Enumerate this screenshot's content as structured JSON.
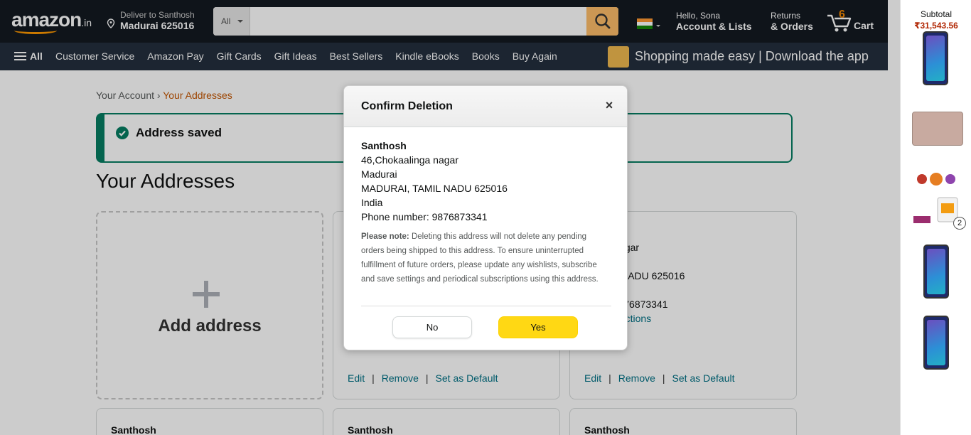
{
  "header": {
    "logo_text": "amazon",
    "logo_suffix": ".in",
    "deliver_line1": "Deliver to Santhosh",
    "deliver_line2": "Madurai 625016",
    "search_category": "All",
    "search_placeholder": "",
    "greeting": "Hello, Sona",
    "account_label": "Account & Lists",
    "returns_line1": "Returns",
    "returns_line2": "& Orders",
    "cart_count": "6",
    "cart_label": "Cart"
  },
  "nav": {
    "all_label": "All",
    "items": [
      "Customer Service",
      "Amazon Pay",
      "Gift Cards",
      "Gift Ideas",
      "Best Sellers",
      "Kindle eBooks",
      "Books",
      "Buy Again"
    ],
    "promo": "Shopping made easy | Download the app"
  },
  "right_panel": {
    "subtotal_label": "Subtotal",
    "subtotal_amount": "₹31,543.56",
    "rakhi_qty": "2"
  },
  "page": {
    "breadcrumb_root": "Your Account",
    "breadcrumb_sep": "›",
    "breadcrumb_current": "Your Addresses",
    "saved_message": "Address saved",
    "heading": "Your Addresses",
    "add_address": "Add address",
    "card3_lines": [
      "alinga nagar",
      "",
      ", TAMIL NADU 625016",
      "",
      "mber: 9876873341"
    ],
    "card3_link": "ery instructions",
    "card_actions": {
      "edit": "Edit",
      "remove": "Remove",
      "default": "Set as Default",
      "sep": "|"
    },
    "bottom_names": [
      "Santhosh",
      "Santhosh",
      "Santhosh"
    ]
  },
  "modal": {
    "title": "Confirm Deletion",
    "close": "×",
    "name": "Santhosh",
    "line1": "46,Chokaalinga nagar",
    "line2": "Madurai",
    "line3": "MADURAI, TAMIL NADU 625016",
    "line4": "India",
    "phone": "Phone number: 9876873341",
    "note_label": "Please note:",
    "note_text": " Deleting this address will not delete any pending orders being shipped to this address. To ensure uninterrupted fulfillment of future orders, please update any wishlists, subscribe and save settings and periodical subscriptions using this address.",
    "no_label": "No",
    "yes_label": "Yes"
  },
  "colors": {
    "header_bg": "#131921",
    "nav_bg": "#232f3e",
    "accent_orange": "#ff9900",
    "success_green": "#067d62",
    "link_teal": "#007185",
    "yes_button": "#ffd814"
  }
}
